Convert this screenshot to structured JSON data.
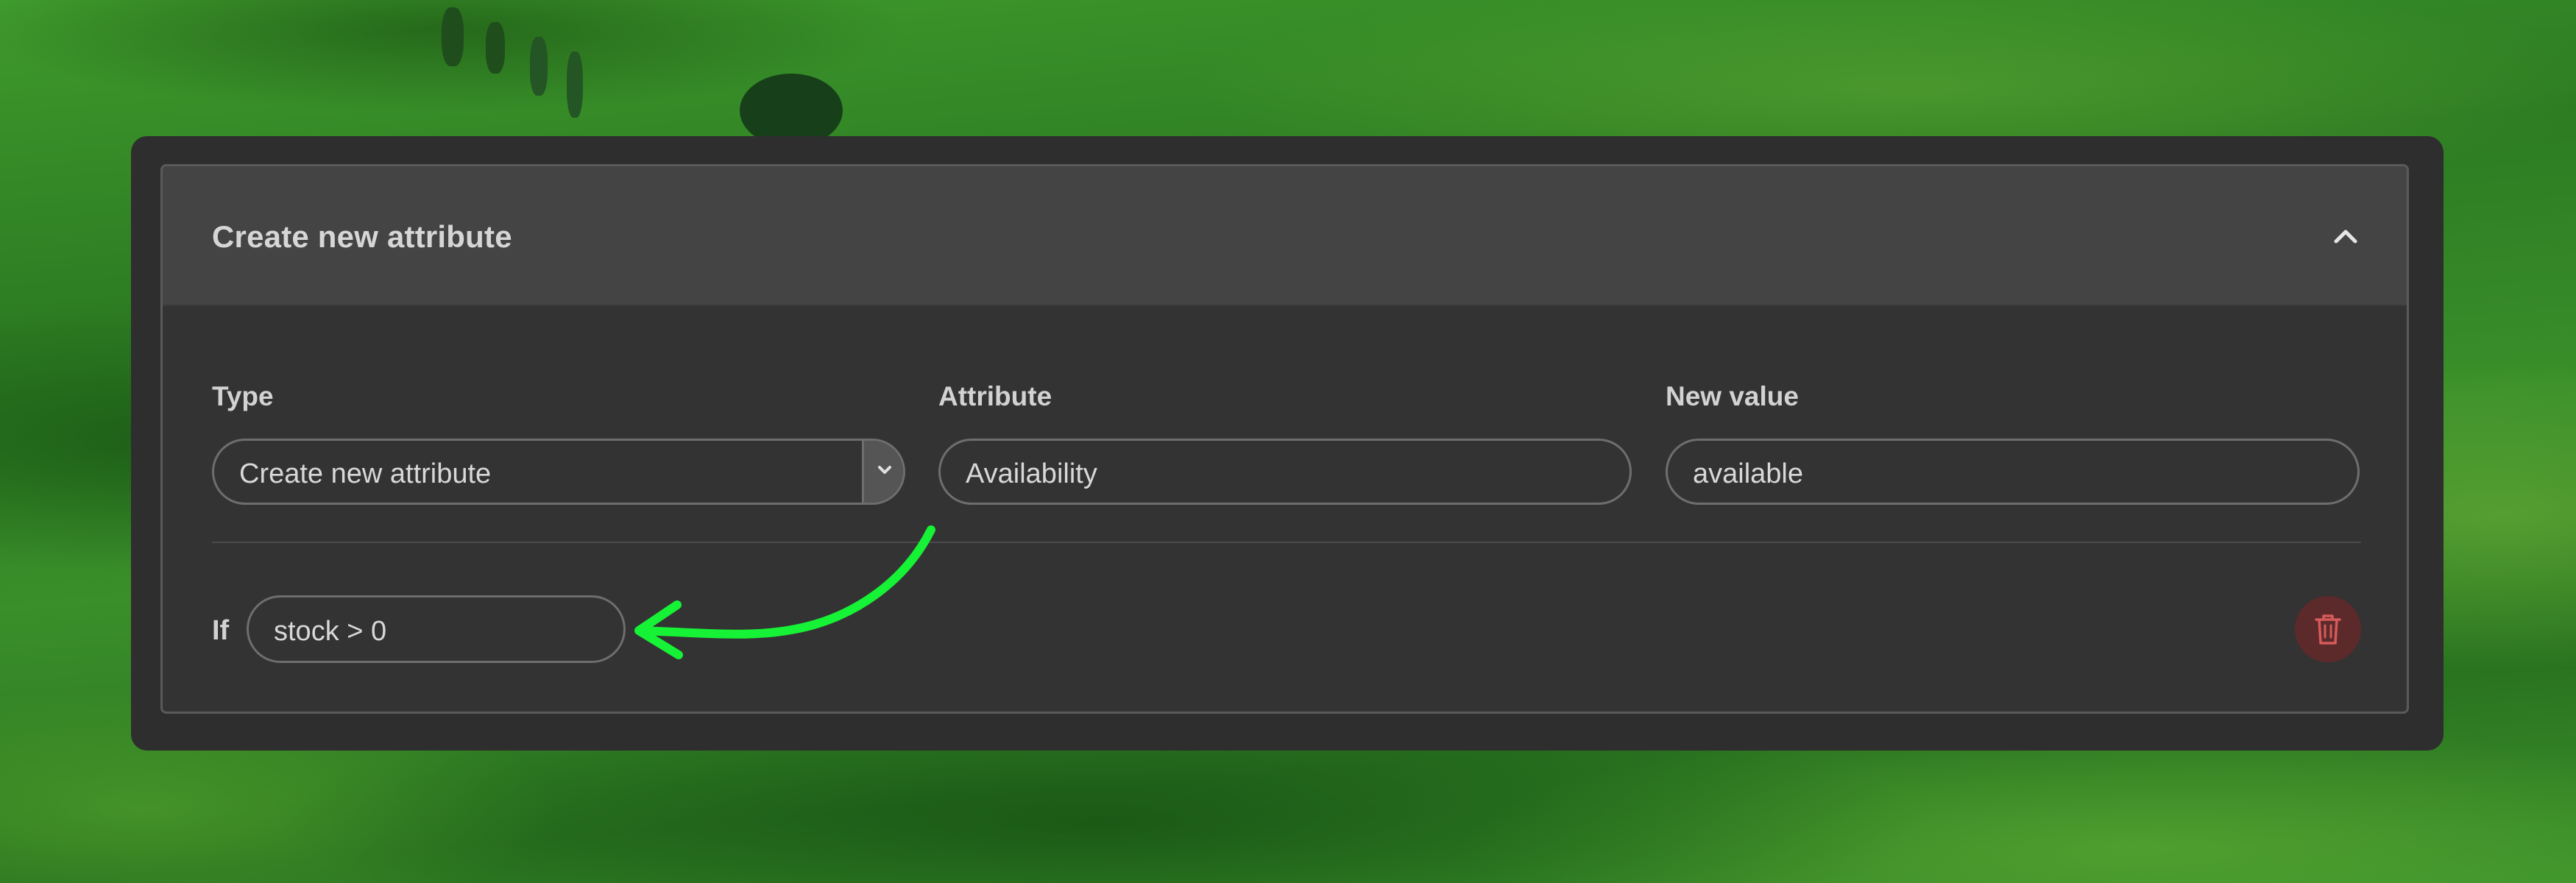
{
  "panel": {
    "title": "Create new attribute",
    "collapse_icon": "chevron-up-icon"
  },
  "fields": {
    "type": {
      "label": "Type",
      "selected": "Create new attribute",
      "icon": "chevron-down-icon"
    },
    "attribute": {
      "label": "Attribute",
      "value": "Availability"
    },
    "new_value": {
      "label": "New value",
      "value": "available"
    }
  },
  "condition": {
    "label": "If",
    "value": "stock > 0"
  },
  "delete": {
    "icon": "trash-icon"
  },
  "colors": {
    "annotation_arrow": "#16f236",
    "delete_button_bg": "#5c2a2a",
    "delete_icon": "#d65a5a",
    "panel_header_bg": "#444444",
    "window_bg": "#2e2e2e"
  }
}
